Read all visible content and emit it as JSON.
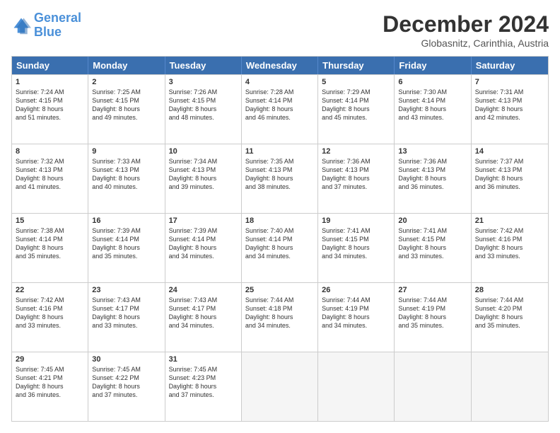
{
  "logo": {
    "line1": "General",
    "line2": "Blue"
  },
  "header": {
    "month": "December 2024",
    "location": "Globasnitz, Carinthia, Austria"
  },
  "days": [
    "Sunday",
    "Monday",
    "Tuesday",
    "Wednesday",
    "Thursday",
    "Friday",
    "Saturday"
  ],
  "weeks": [
    [
      {
        "num": "1",
        "text": "Sunrise: 7:24 AM\nSunset: 4:15 PM\nDaylight: 8 hours\nand 51 minutes."
      },
      {
        "num": "2",
        "text": "Sunrise: 7:25 AM\nSunset: 4:15 PM\nDaylight: 8 hours\nand 49 minutes."
      },
      {
        "num": "3",
        "text": "Sunrise: 7:26 AM\nSunset: 4:15 PM\nDaylight: 8 hours\nand 48 minutes."
      },
      {
        "num": "4",
        "text": "Sunrise: 7:28 AM\nSunset: 4:14 PM\nDaylight: 8 hours\nand 46 minutes."
      },
      {
        "num": "5",
        "text": "Sunrise: 7:29 AM\nSunset: 4:14 PM\nDaylight: 8 hours\nand 45 minutes."
      },
      {
        "num": "6",
        "text": "Sunrise: 7:30 AM\nSunset: 4:14 PM\nDaylight: 8 hours\nand 43 minutes."
      },
      {
        "num": "7",
        "text": "Sunrise: 7:31 AM\nSunset: 4:13 PM\nDaylight: 8 hours\nand 42 minutes."
      }
    ],
    [
      {
        "num": "8",
        "text": "Sunrise: 7:32 AM\nSunset: 4:13 PM\nDaylight: 8 hours\nand 41 minutes."
      },
      {
        "num": "9",
        "text": "Sunrise: 7:33 AM\nSunset: 4:13 PM\nDaylight: 8 hours\nand 40 minutes."
      },
      {
        "num": "10",
        "text": "Sunrise: 7:34 AM\nSunset: 4:13 PM\nDaylight: 8 hours\nand 39 minutes."
      },
      {
        "num": "11",
        "text": "Sunrise: 7:35 AM\nSunset: 4:13 PM\nDaylight: 8 hours\nand 38 minutes."
      },
      {
        "num": "12",
        "text": "Sunrise: 7:36 AM\nSunset: 4:13 PM\nDaylight: 8 hours\nand 37 minutes."
      },
      {
        "num": "13",
        "text": "Sunrise: 7:36 AM\nSunset: 4:13 PM\nDaylight: 8 hours\nand 36 minutes."
      },
      {
        "num": "14",
        "text": "Sunrise: 7:37 AM\nSunset: 4:13 PM\nDaylight: 8 hours\nand 36 minutes."
      }
    ],
    [
      {
        "num": "15",
        "text": "Sunrise: 7:38 AM\nSunset: 4:14 PM\nDaylight: 8 hours\nand 35 minutes."
      },
      {
        "num": "16",
        "text": "Sunrise: 7:39 AM\nSunset: 4:14 PM\nDaylight: 8 hours\nand 35 minutes."
      },
      {
        "num": "17",
        "text": "Sunrise: 7:39 AM\nSunset: 4:14 PM\nDaylight: 8 hours\nand 34 minutes."
      },
      {
        "num": "18",
        "text": "Sunrise: 7:40 AM\nSunset: 4:14 PM\nDaylight: 8 hours\nand 34 minutes."
      },
      {
        "num": "19",
        "text": "Sunrise: 7:41 AM\nSunset: 4:15 PM\nDaylight: 8 hours\nand 34 minutes."
      },
      {
        "num": "20",
        "text": "Sunrise: 7:41 AM\nSunset: 4:15 PM\nDaylight: 8 hours\nand 33 minutes."
      },
      {
        "num": "21",
        "text": "Sunrise: 7:42 AM\nSunset: 4:16 PM\nDaylight: 8 hours\nand 33 minutes."
      }
    ],
    [
      {
        "num": "22",
        "text": "Sunrise: 7:42 AM\nSunset: 4:16 PM\nDaylight: 8 hours\nand 33 minutes."
      },
      {
        "num": "23",
        "text": "Sunrise: 7:43 AM\nSunset: 4:17 PM\nDaylight: 8 hours\nand 33 minutes."
      },
      {
        "num": "24",
        "text": "Sunrise: 7:43 AM\nSunset: 4:17 PM\nDaylight: 8 hours\nand 34 minutes."
      },
      {
        "num": "25",
        "text": "Sunrise: 7:44 AM\nSunset: 4:18 PM\nDaylight: 8 hours\nand 34 minutes."
      },
      {
        "num": "26",
        "text": "Sunrise: 7:44 AM\nSunset: 4:19 PM\nDaylight: 8 hours\nand 34 minutes."
      },
      {
        "num": "27",
        "text": "Sunrise: 7:44 AM\nSunset: 4:19 PM\nDaylight: 8 hours\nand 35 minutes."
      },
      {
        "num": "28",
        "text": "Sunrise: 7:44 AM\nSunset: 4:20 PM\nDaylight: 8 hours\nand 35 minutes."
      }
    ],
    [
      {
        "num": "29",
        "text": "Sunrise: 7:45 AM\nSunset: 4:21 PM\nDaylight: 8 hours\nand 36 minutes."
      },
      {
        "num": "30",
        "text": "Sunrise: 7:45 AM\nSunset: 4:22 PM\nDaylight: 8 hours\nand 37 minutes."
      },
      {
        "num": "31",
        "text": "Sunrise: 7:45 AM\nSunset: 4:23 PM\nDaylight: 8 hours\nand 37 minutes."
      },
      {
        "num": "",
        "text": ""
      },
      {
        "num": "",
        "text": ""
      },
      {
        "num": "",
        "text": ""
      },
      {
        "num": "",
        "text": ""
      }
    ]
  ]
}
